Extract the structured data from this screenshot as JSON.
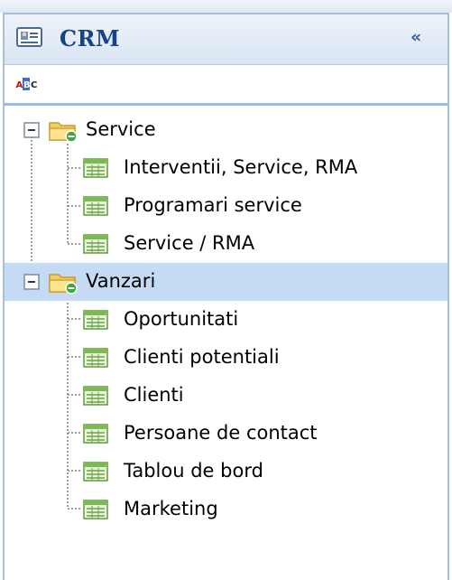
{
  "panel": {
    "title": "CRM",
    "collapse_icon": "double-chevron-left-icon",
    "title_icon": "card-icon"
  },
  "toolbar": {
    "sort_icon": "abc-sort-icon"
  },
  "tree": {
    "groups": [
      {
        "label": "Service",
        "expanded": true,
        "selected": false,
        "children": [
          {
            "label": "Interventii, Service, RMA"
          },
          {
            "label": "Programari service"
          },
          {
            "label": "Service / RMA"
          }
        ]
      },
      {
        "label": "Vanzari",
        "expanded": true,
        "selected": true,
        "children": [
          {
            "label": "Oportunitati"
          },
          {
            "label": "Clienti potentiali"
          },
          {
            "label": "Clienti"
          },
          {
            "label": "Persoane de contact"
          },
          {
            "label": "Tablou de bord"
          },
          {
            "label": "Marketing"
          }
        ]
      }
    ]
  },
  "colors": {
    "header_text": "#15428b",
    "selection": "#c5dbf4",
    "border": "#a8bfdb"
  }
}
